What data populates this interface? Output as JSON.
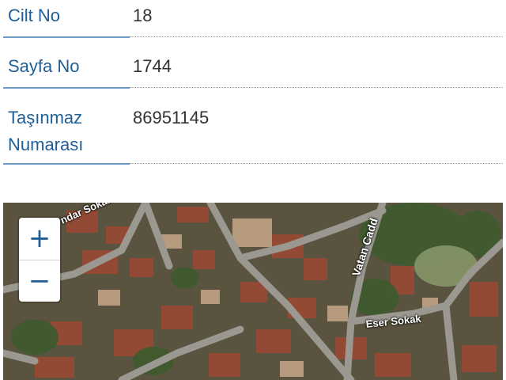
{
  "rows": [
    {
      "label": "Cilt No",
      "value": "18"
    },
    {
      "label": "Sayfa No",
      "value": "1744"
    },
    {
      "label": "Taşınmaz\nNumarası",
      "value": "86951145"
    }
  ],
  "map": {
    "zoom_in_label": "+",
    "zoom_out_label": "−",
    "street_labels": [
      "ndar Sokak",
      "Vatan Cadd",
      "Eser Sokak"
    ]
  }
}
